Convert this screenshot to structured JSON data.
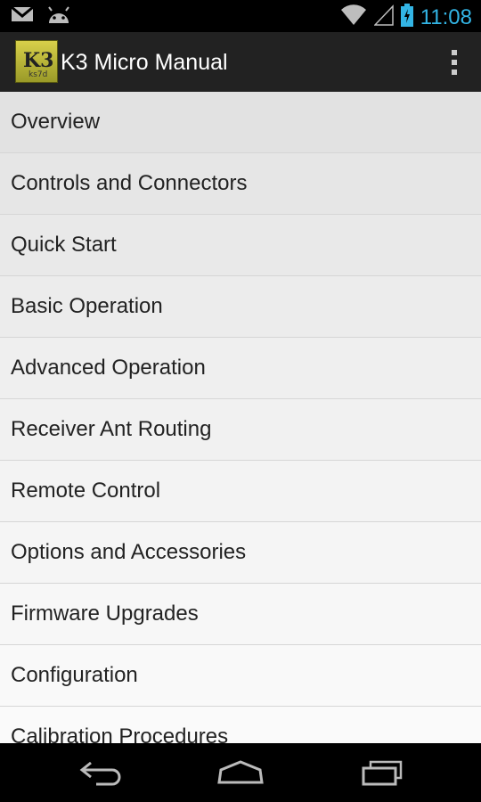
{
  "status_bar": {
    "time": "11:08",
    "icons": [
      "gmail-icon",
      "android-icon",
      "wifi-icon",
      "signal-icon",
      "battery-charging-icon"
    ]
  },
  "action_bar": {
    "title": "K3 Micro Manual",
    "app_icon": {
      "text": "K3",
      "subtext": "ks7d"
    }
  },
  "menu": {
    "items": [
      {
        "label": "Overview"
      },
      {
        "label": "Controls and Connectors"
      },
      {
        "label": "Quick Start"
      },
      {
        "label": "Basic Operation"
      },
      {
        "label": "Advanced Operation"
      },
      {
        "label": "Receiver Ant Routing"
      },
      {
        "label": "Remote Control"
      },
      {
        "label": "Options and Accessories"
      },
      {
        "label": "Firmware Upgrades"
      },
      {
        "label": "Configuration"
      },
      {
        "label": "Calibration Procedures"
      }
    ]
  },
  "nav_bar": {
    "buttons": [
      "back-icon",
      "home-icon",
      "recent-apps-icon"
    ]
  },
  "colors": {
    "accent": "#33b5e5",
    "action_bar": "#222222",
    "status_bar": "#000000"
  }
}
